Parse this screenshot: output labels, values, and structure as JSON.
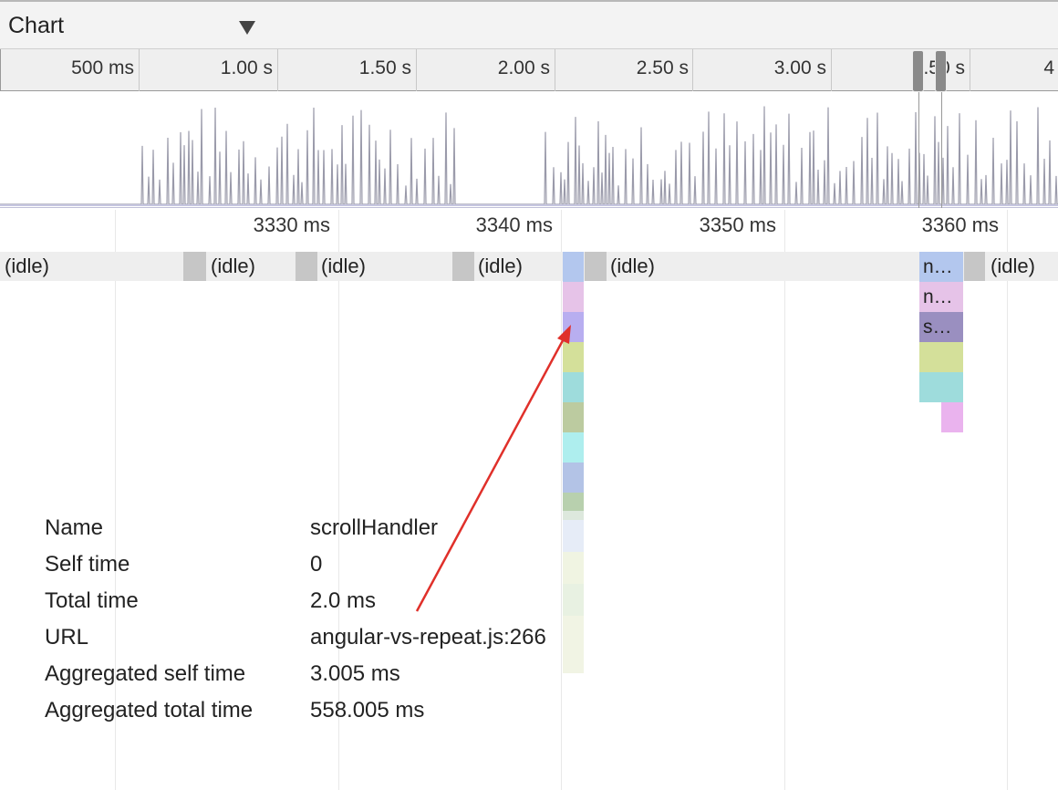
{
  "toolbar": {
    "mode_label": "Chart"
  },
  "overview_ruler": {
    "labels": [
      "500 ms",
      "1.00 s",
      "1.50 s",
      "2.00 s",
      "2.50 s",
      "3.00 s",
      "3.50 s",
      "4"
    ]
  },
  "flame_ruler": {
    "labels": [
      "3330 ms",
      "3340 ms",
      "3350 ms",
      "3360 ms"
    ]
  },
  "idle_row": {
    "labels": [
      "(idle)",
      "(idle)",
      "(idle)",
      "(idle)",
      "(idle)",
      "(idle)"
    ]
  },
  "frames": {
    "right_labels": [
      "n…",
      "n…",
      "s…"
    ]
  },
  "details": {
    "rows": [
      {
        "key": "Name",
        "value": "scrollHandler"
      },
      {
        "key": "Self time",
        "value": "0"
      },
      {
        "key": "Total time",
        "value": "2.0 ms"
      },
      {
        "key": "URL",
        "value": "angular-vs-repeat.js:266"
      },
      {
        "key": "Aggregated self time",
        "value": "3.005 ms"
      },
      {
        "key": "Aggregated total time",
        "value": "558.005 ms"
      }
    ]
  },
  "colors": {
    "annotation_arrow": "#e0302a",
    "overview_trace": "#9a9aaa"
  }
}
